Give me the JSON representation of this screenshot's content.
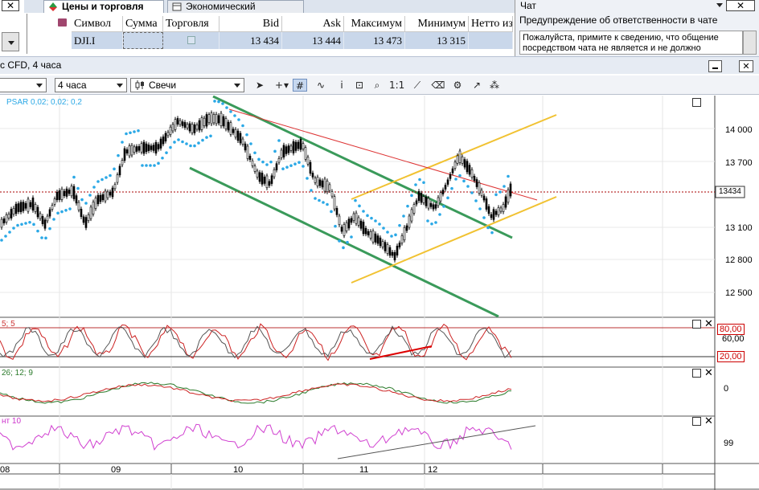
{
  "window": {
    "close_glyph": "✕"
  },
  "tabs": [
    {
      "label": "Цены и торговля",
      "icon": "prices-tree-icon"
    },
    {
      "label": "Экономический календарь",
      "icon": "calendar-icon"
    }
  ],
  "table": {
    "headers": [
      "Символ",
      "Сумма",
      "Торговля",
      "Bid",
      "Ask",
      "Максимум",
      "Минимум",
      "Нетто из"
    ],
    "row": {
      "symbol": "DJI.I",
      "amount": "",
      "bid": "13 434",
      "ask": "13 444",
      "high": "13 473",
      "low": "13 315"
    }
  },
  "chat": {
    "title": "Чат",
    "close_glyph": "✕",
    "warning_title": "Предупреждение об ответственности в чате",
    "message": "Пожалуйста, примите к сведению, что общение посредством чата не является и не должно"
  },
  "chart": {
    "title": "с CFD, 4 часа",
    "timeframe": "4 часа",
    "chart_type": "Свечи",
    "indicator_psar": "PSAR 0,02; 0,02; 0,2",
    "stoch_label": "5; 5",
    "macd_label": "26; 12; 9",
    "mom_label": "нт 10",
    "current_price": "13434",
    "price_ticks": [
      "14 000",
      "13 700",
      "13 400",
      "13 100",
      "12 800",
      "12 500"
    ],
    "stoch_levels": {
      "upper": "80,00",
      "mid": "60,00",
      "lower": "20,00"
    },
    "macd_tick": "0",
    "mom_tick": "99",
    "dates": [
      "08",
      "09",
      "10",
      "11",
      "12"
    ],
    "colors": {
      "psar": "#2aa8e6",
      "channel": "#3a9a5a",
      "yellow": "#f1c232",
      "red_line": "#d33",
      "candle": "#000"
    }
  }
}
